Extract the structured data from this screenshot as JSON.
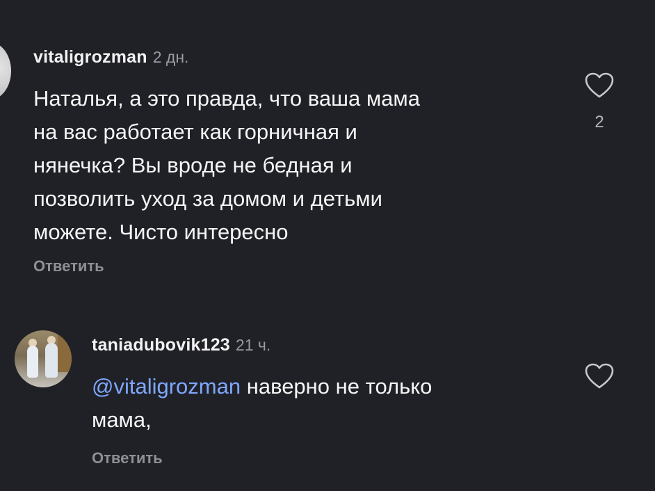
{
  "comments": [
    {
      "username": "vitaligrozman",
      "time": "2 дн.",
      "text_lines": [
        "Наталья, а это правда, что ваша мама",
        "на вас работает как горничная и",
        "нянечка? Вы вроде не бедная и",
        "позволить уход за домом и детьми",
        "можете. Чисто интересно"
      ],
      "reply_label": "Ответить",
      "likes": "2",
      "icon": "heart-icon"
    },
    {
      "username": "taniadubovik123",
      "time": "21 ч.",
      "mention": "@vitaligrozman",
      "text_line1_rest": " наверно не только",
      "text_line2": "мама,",
      "reply_label": "Ответить",
      "icon": "heart-icon"
    }
  ],
  "colors": {
    "background": "#202126",
    "text": "#f5f5f5",
    "muted": "#8f8f95",
    "mention": "#7ea7ff"
  }
}
